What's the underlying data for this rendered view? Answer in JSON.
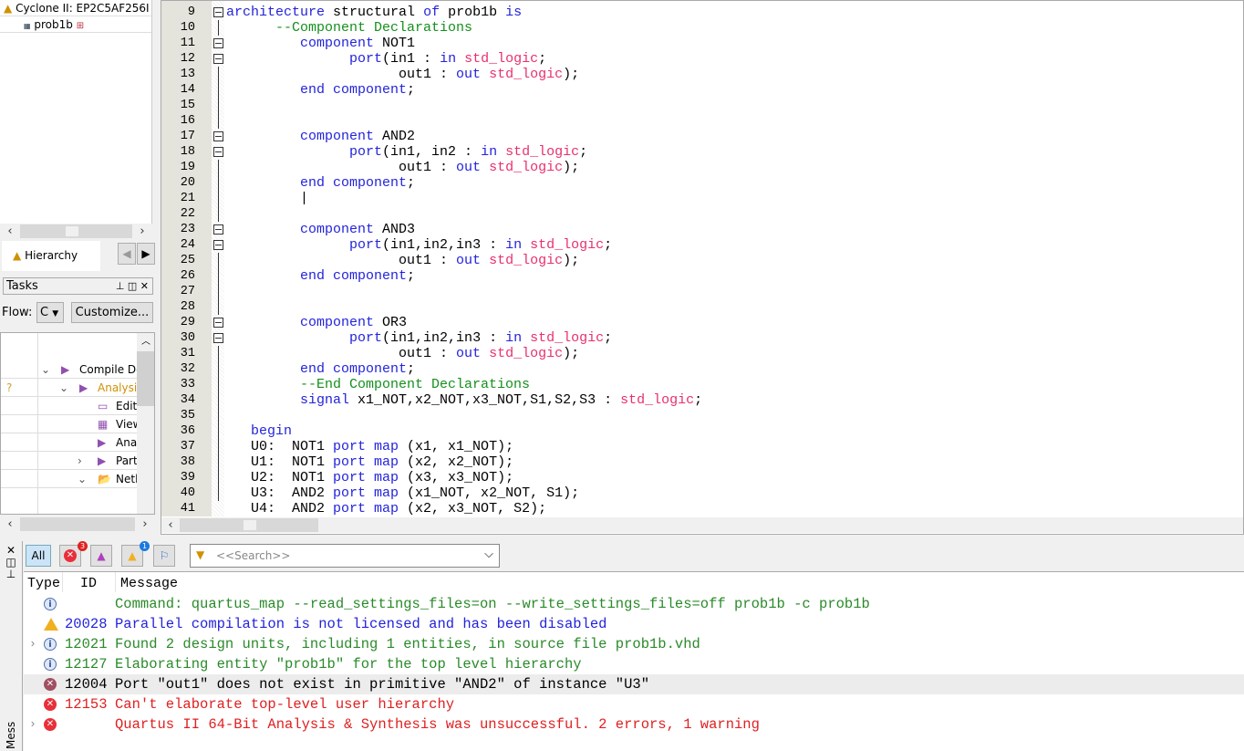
{
  "hierarchy": {
    "device": "Cyclone II: EP2C5AF256I",
    "entity": "prob1b",
    "tab_label": "Hierarchy"
  },
  "tasks": {
    "title": "Tasks",
    "flow_label": "Flow:",
    "flow_value": "C",
    "customize_label": "Customize...",
    "items": [
      {
        "label": "Compile Design",
        "status": ""
      },
      {
        "label": "Analysis & Synthesis",
        "status": "?"
      },
      {
        "label": "Edit Settings",
        "status": ""
      },
      {
        "label": "View Report",
        "status": ""
      },
      {
        "label": "Analysis & Elaboration",
        "status": ""
      },
      {
        "label": "Partition Merge",
        "status": ""
      },
      {
        "label": "Netlist Viewers",
        "status": ""
      }
    ]
  },
  "editor": {
    "lines": [
      {
        "n": "9",
        "fold": "box",
        "t": [
          [
            "architecture",
            "kw"
          ],
          [
            " structural ",
            "tx"
          ],
          [
            "of",
            "kw"
          ],
          [
            " prob1b ",
            "tx"
          ],
          [
            "is",
            "kw"
          ]
        ]
      },
      {
        "n": "10",
        "t": [
          [
            "      --Component Declarations",
            "cm"
          ]
        ]
      },
      {
        "n": "11",
        "fold": "box",
        "t": [
          [
            "         ",
            "tx"
          ],
          [
            "component",
            "kw"
          ],
          [
            " NOT1",
            "tx"
          ]
        ]
      },
      {
        "n": "12",
        "fold": "box",
        "t": [
          [
            "               ",
            "tx"
          ],
          [
            "port",
            "kw"
          ],
          [
            "(in1 : ",
            "tx"
          ],
          [
            "in",
            "kw"
          ],
          [
            " ",
            "tx"
          ],
          [
            "std_logic",
            "ty"
          ],
          [
            ";",
            "tx"
          ]
        ]
      },
      {
        "n": "13",
        "t": [
          [
            "                     out1 : ",
            "tx"
          ],
          [
            "out",
            "kw"
          ],
          [
            " ",
            "tx"
          ],
          [
            "std_logic",
            "ty"
          ],
          [
            ");",
            "tx"
          ]
        ]
      },
      {
        "n": "14",
        "t": [
          [
            "         ",
            "tx"
          ],
          [
            "end component",
            "kw"
          ],
          [
            ";",
            "tx"
          ]
        ]
      },
      {
        "n": "15",
        "t": []
      },
      {
        "n": "16",
        "t": []
      },
      {
        "n": "17",
        "fold": "box",
        "t": [
          [
            "         ",
            "tx"
          ],
          [
            "component",
            "kw"
          ],
          [
            " AND2",
            "tx"
          ]
        ]
      },
      {
        "n": "18",
        "fold": "box",
        "t": [
          [
            "               ",
            "tx"
          ],
          [
            "port",
            "kw"
          ],
          [
            "(in1, in2 : ",
            "tx"
          ],
          [
            "in",
            "kw"
          ],
          [
            " ",
            "tx"
          ],
          [
            "std_logic",
            "ty"
          ],
          [
            ";",
            "tx"
          ]
        ]
      },
      {
        "n": "19",
        "t": [
          [
            "                     out1 : ",
            "tx"
          ],
          [
            "out",
            "kw"
          ],
          [
            " ",
            "tx"
          ],
          [
            "std_logic",
            "ty"
          ],
          [
            ");",
            "tx"
          ]
        ]
      },
      {
        "n": "20",
        "t": [
          [
            "         ",
            "tx"
          ],
          [
            "end component",
            "kw"
          ],
          [
            ";",
            "tx"
          ]
        ]
      },
      {
        "n": "21",
        "t": [
          [
            "         |",
            "tx"
          ]
        ]
      },
      {
        "n": "22",
        "t": []
      },
      {
        "n": "23",
        "fold": "box",
        "t": [
          [
            "         ",
            "tx"
          ],
          [
            "component",
            "kw"
          ],
          [
            " AND3",
            "tx"
          ]
        ]
      },
      {
        "n": "24",
        "fold": "box",
        "t": [
          [
            "               ",
            "tx"
          ],
          [
            "port",
            "kw"
          ],
          [
            "(in1,in2,in3 : ",
            "tx"
          ],
          [
            "in",
            "kw"
          ],
          [
            " ",
            "tx"
          ],
          [
            "std_logic",
            "ty"
          ],
          [
            ";",
            "tx"
          ]
        ]
      },
      {
        "n": "25",
        "t": [
          [
            "                     out1 : ",
            "tx"
          ],
          [
            "out",
            "kw"
          ],
          [
            " ",
            "tx"
          ],
          [
            "std_logic",
            "ty"
          ],
          [
            ");",
            "tx"
          ]
        ]
      },
      {
        "n": "26",
        "t": [
          [
            "         ",
            "tx"
          ],
          [
            "end component",
            "kw"
          ],
          [
            ";",
            "tx"
          ]
        ]
      },
      {
        "n": "27",
        "t": []
      },
      {
        "n": "28",
        "t": []
      },
      {
        "n": "29",
        "fold": "box",
        "t": [
          [
            "         ",
            "tx"
          ],
          [
            "component",
            "kw"
          ],
          [
            " OR3",
            "tx"
          ]
        ]
      },
      {
        "n": "30",
        "fold": "box",
        "t": [
          [
            "               ",
            "tx"
          ],
          [
            "port",
            "kw"
          ],
          [
            "(in1,in2,in3 : ",
            "tx"
          ],
          [
            "in",
            "kw"
          ],
          [
            " ",
            "tx"
          ],
          [
            "std_logic",
            "ty"
          ],
          [
            ";",
            "tx"
          ]
        ]
      },
      {
        "n": "31",
        "t": [
          [
            "                     out1 : ",
            "tx"
          ],
          [
            "out",
            "kw"
          ],
          [
            " ",
            "tx"
          ],
          [
            "std_logic",
            "ty"
          ],
          [
            ");",
            "tx"
          ]
        ]
      },
      {
        "n": "32",
        "t": [
          [
            "         ",
            "tx"
          ],
          [
            "end component",
            "kw"
          ],
          [
            ";",
            "tx"
          ]
        ]
      },
      {
        "n": "33",
        "t": [
          [
            "         --End Component Declarations",
            "cm"
          ]
        ]
      },
      {
        "n": "34",
        "t": [
          [
            "         ",
            "tx"
          ],
          [
            "signal",
            "kw"
          ],
          [
            " x1_NOT,x2_NOT,x3_NOT,S1,S2,S3 : ",
            "tx"
          ],
          [
            "std_logic",
            "ty"
          ],
          [
            ";",
            "tx"
          ]
        ]
      },
      {
        "n": "35",
        "t": []
      },
      {
        "n": "36",
        "t": [
          [
            "   ",
            "tx"
          ],
          [
            "begin",
            "kw"
          ]
        ]
      },
      {
        "n": "37",
        "t": [
          [
            "   U0:  NOT1 ",
            "tx"
          ],
          [
            "port map",
            "kw"
          ],
          [
            " (x1, x1_NOT);",
            "tx"
          ]
        ]
      },
      {
        "n": "38",
        "t": [
          [
            "   U1:  NOT1 ",
            "tx"
          ],
          [
            "port map",
            "kw"
          ],
          [
            " (x2, x2_NOT);",
            "tx"
          ]
        ]
      },
      {
        "n": "39",
        "t": [
          [
            "   U2:  NOT1 ",
            "tx"
          ],
          [
            "port map",
            "kw"
          ],
          [
            " (x3, x3_NOT);",
            "tx"
          ]
        ]
      },
      {
        "n": "40",
        "t": [
          [
            "   U3:  AND2 ",
            "tx"
          ],
          [
            "port map",
            "kw"
          ],
          [
            " (x1_NOT, x2_NOT, S1);",
            "tx"
          ]
        ]
      },
      {
        "n": "41",
        "t": [
          [
            "   U4:  AND2 ",
            "tx"
          ],
          [
            "port map",
            "kw"
          ],
          [
            " (x2, x3_NOT, S2);",
            "tx"
          ]
        ]
      }
    ]
  },
  "messages": {
    "side_label": "Messages",
    "filters": {
      "all": "All",
      "error_count": "3",
      "warning_count": "1"
    },
    "search_placeholder": "<<Search>>",
    "columns": {
      "type": "Type",
      "id": "ID",
      "message": "Message"
    },
    "rows": [
      {
        "type": "info",
        "id": "",
        "text": "Command: quartus_map --read_settings_files=on --write_settings_files=off prob1b -c prob1b",
        "color": "#2a8a2a"
      },
      {
        "type": "warning",
        "id": "20028",
        "text": "Parallel compilation is not licensed and has been disabled",
        "color": "#2323dc"
      },
      {
        "type": "info",
        "id": "12021",
        "text": "Found 2 design units, including 1 entities, in source file prob1b.vhd",
        "color": "#2a8a2a",
        "expand": true
      },
      {
        "type": "info",
        "id": "12127",
        "text": "Elaborating entity \"prob1b\" for the top level hierarchy",
        "color": "#2a8a2a"
      },
      {
        "type": "error-selected",
        "id": "12004",
        "text": "Port \"out1\" does not exist in primitive \"AND2\" of instance \"U3\"",
        "color": "#000000",
        "selected": true
      },
      {
        "type": "error",
        "id": "12153",
        "text": "Can't elaborate top-level user hierarchy",
        "color": "#e02020"
      },
      {
        "type": "error",
        "id": "",
        "text": "Quartus II 64-Bit Analysis & Synthesis was unsuccessful. 2 errors, 1 warning",
        "color": "#e02020",
        "expand": true
      }
    ]
  }
}
